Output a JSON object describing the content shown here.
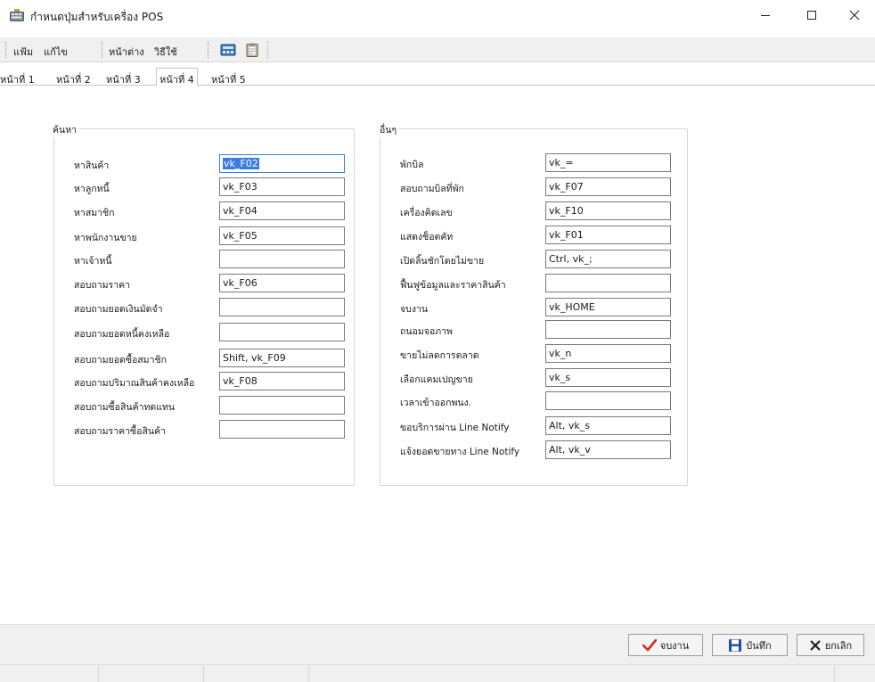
{
  "window": {
    "title": "กำหนดปุ่มสำหรับเครื่อง POS",
    "icon": "keyboard-app-icon"
  },
  "menu": {
    "items": [
      "แฟ้ม",
      "แก้ไข",
      "หน้าต่าง",
      "วิธีใช้"
    ]
  },
  "toolbar": {
    "icons": [
      "calculator-icon",
      "clipboard-icon"
    ]
  },
  "tabs": {
    "labels": [
      "หน้าที่ 1",
      "หน้าที่ 2",
      "หน้าที่ 3",
      "หน้าที่ 4",
      "หน้าที่ 5"
    ],
    "active": "หน้าที่ 4"
  },
  "search_group": {
    "title": "ค้นหา",
    "rows": [
      {
        "label": "หาสินค้า",
        "value": "vk_F02"
      },
      {
        "label": "หาลูกหนี้",
        "value": "vk_F03"
      },
      {
        "label": "หาสมาชิก",
        "value": "vk_F04"
      },
      {
        "label": "หาพนักงานขาย",
        "value": "vk_F05"
      },
      {
        "label": "หาเจ้าหนี้",
        "value": ""
      },
      {
        "label": "สอบถามราคา",
        "value": "vk_F06"
      },
      {
        "label": "สอบถามยอดเงินมัดจำ",
        "value": ""
      },
      {
        "label": "สอบถามยอดหนี้คงเหลือ",
        "value": ""
      },
      {
        "label": "สอบถามยอดซื้อสมาชิก",
        "value": "Shift, vk_F09"
      },
      {
        "label": "สอบถามปริมาณสินค้าคงเหลือ",
        "value": "vk_F08"
      },
      {
        "label": "สอบถามซื้อสินค้าทดแทน",
        "value": ""
      },
      {
        "label": "สอบถามราคาซื้อสินค้า",
        "value": ""
      }
    ]
  },
  "other_group": {
    "title": "อื่นๆ",
    "rows": [
      {
        "label": "พักบิล",
        "value": "vk_="
      },
      {
        "label": "สอบถามบิลที่พัก",
        "value": "vk_F07"
      },
      {
        "label": "เครื่องคิดเลข",
        "value": "vk_F10"
      },
      {
        "label": "แสดงช็อตคัท",
        "value": "vk_F01"
      },
      {
        "label": "เปิดลิ้นชักโดยไม่ขาย",
        "value": "Ctrl, vk_;"
      },
      {
        "label": "ฟื้นฟูข้อมูลและราคาสินค้า",
        "value": ""
      },
      {
        "label": "จบงาน",
        "value": "vk_HOME"
      },
      {
        "label": "ถนอมจอภาพ",
        "value": ""
      },
      {
        "label": "ขายไม่ลดการตลาด",
        "value": "vk_n"
      },
      {
        "label": "เลือกแคมเปญขาย",
        "value": "vk_s"
      },
      {
        "label": "เวลาเข้าออกพนง.",
        "value": ""
      },
      {
        "label": "ขอบริการผ่าน Line Notify",
        "value": "Alt, vk_s"
      },
      {
        "label": "แจ้งยอดขายทาง Line Notify",
        "value": "Alt, vk_v"
      }
    ]
  },
  "buttons": {
    "finish": {
      "label": "จบงาน",
      "icon": "checkmark-icon",
      "color": "#d62a1f"
    },
    "save": {
      "label": "บันทึก",
      "icon": "save-disk-icon",
      "color": "#1f4fa8"
    },
    "cancel": {
      "label": "ยกเลิก",
      "icon": "close-x-icon"
    }
  }
}
